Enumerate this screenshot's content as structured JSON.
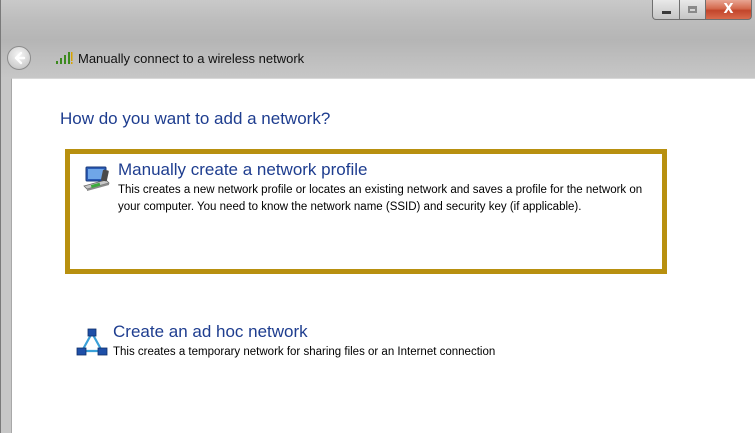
{
  "window": {
    "title": "Manually connect to a wireless network",
    "caption_buttons": {
      "minimize": "minimize-icon",
      "maximize": "maximize-icon",
      "close": "close-icon",
      "close_glyph": "X"
    },
    "back_icon": "back-arrow-icon",
    "title_icon": "wireless-signal-icon"
  },
  "content": {
    "heading": "How do you want to add a network?",
    "options": [
      {
        "icon": "network-profile-icon",
        "title": "Manually create a network profile",
        "description": "This creates a new network profile or locates an existing network and saves a profile for the network on your computer. You need to know the network name (SSID) and security key (if applicable).",
        "highlighted": true
      },
      {
        "icon": "ad-hoc-network-icon",
        "title": "Create an ad hoc network",
        "description": "This creates a temporary network for sharing files or an Internet connection",
        "highlighted": false
      }
    ]
  },
  "colors": {
    "link_blue": "#1e3d8f",
    "highlight_border": "#b8900f",
    "close_red": "#c2452b"
  }
}
